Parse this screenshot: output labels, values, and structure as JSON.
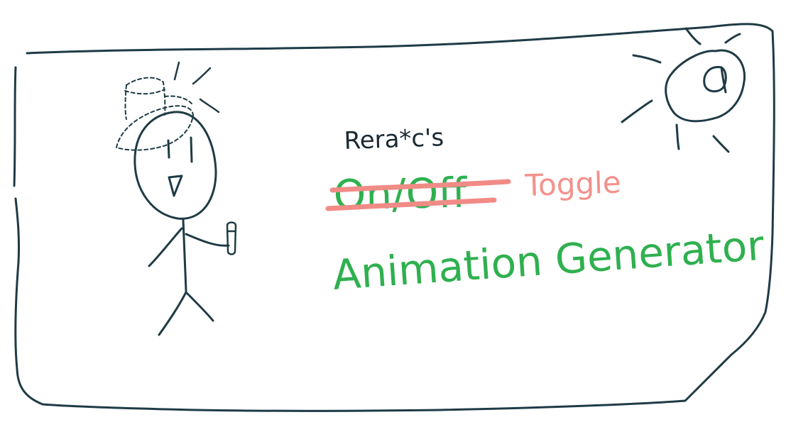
{
  "title": {
    "author": "Rera*c's",
    "crossed_out": "On/Off",
    "replacement": "Toggle",
    "subtitle": "Animation Generator"
  },
  "colors": {
    "frame": "#1f3b45",
    "author": "#1a2a33",
    "green": "#2fb04f",
    "strike": "#f08b86",
    "toggle": "#f4918c"
  },
  "icons": {
    "sun": "sun-icon",
    "stick_figure": "stick-figure-icon",
    "hat": "hat-icon",
    "flashlight": "flashlight-icon"
  }
}
